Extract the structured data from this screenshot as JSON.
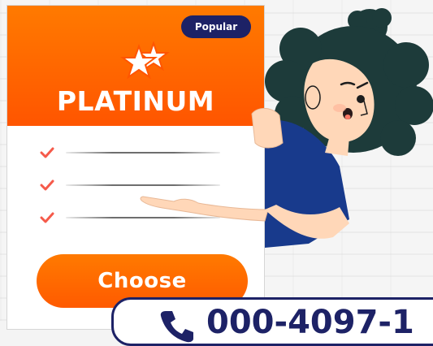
{
  "card": {
    "badge": "Popular",
    "plan_name": "PLATINUM",
    "features": [
      "",
      "",
      ""
    ],
    "cta_label": "Choose"
  },
  "phone": {
    "number": "000-4097-1"
  },
  "colors": {
    "header_orange": "#ff6a00",
    "badge_navy": "#1d2266",
    "check_color": "#f55a4a",
    "shirt_blue": "#183a8c",
    "skin": "#ffd7b8",
    "hair": "#1d3b3a"
  },
  "icons": {
    "stars": "star-icon",
    "check": "check-icon",
    "phone": "phone-icon"
  }
}
